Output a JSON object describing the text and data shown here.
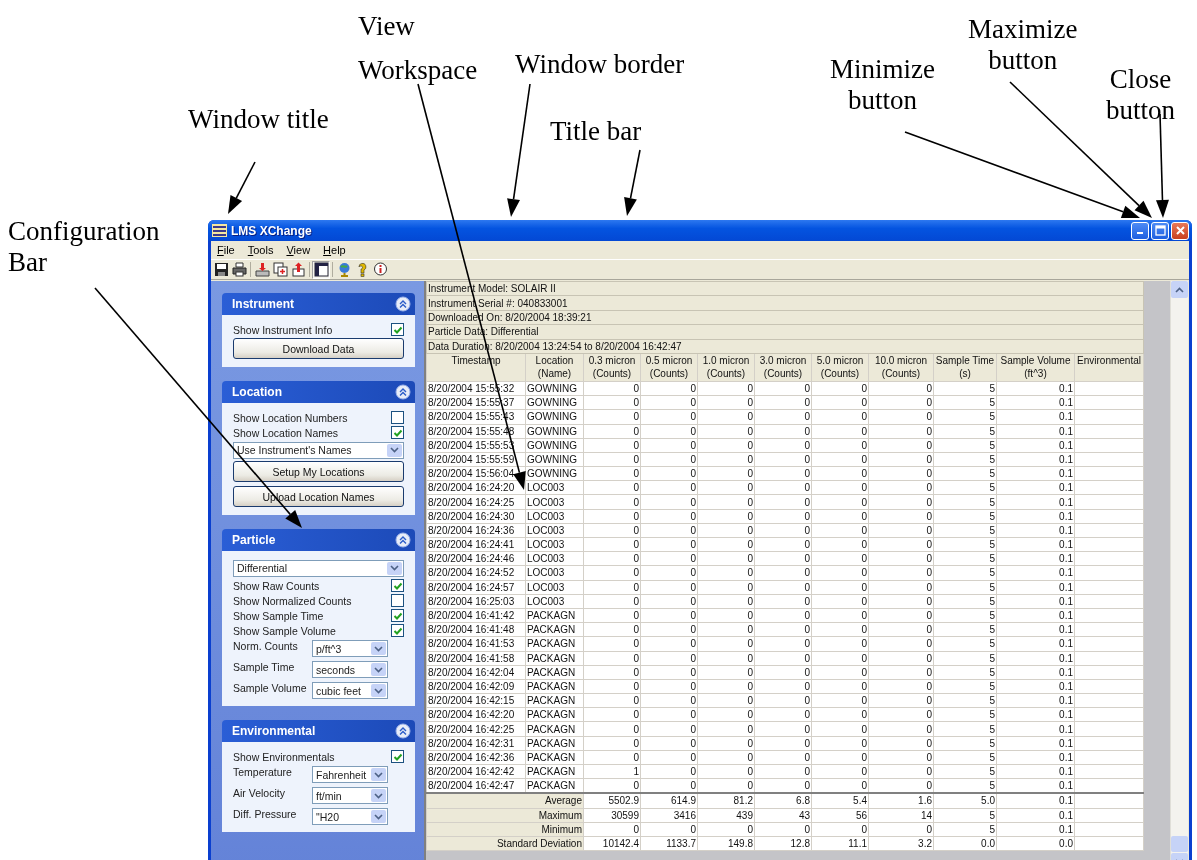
{
  "annotations": [
    {
      "text": "Window title"
    },
    {
      "text": "Configuration\nBar"
    },
    {
      "text": "View\nWorkspace"
    },
    {
      "text": "Window border"
    },
    {
      "text": "Title bar"
    },
    {
      "text": "Minimize\nbutton"
    },
    {
      "text": "Maximize\nbutton"
    },
    {
      "text": "Close\nbutton"
    }
  ],
  "window": {
    "title": "LMS XChange",
    "menu": [
      "File",
      "Tools",
      "View",
      "Help"
    ],
    "toolbar": [
      {
        "kind": "save",
        "pressed": false
      },
      {
        "kind": "print",
        "pressed": false
      },
      {
        "kind": "separator"
      },
      {
        "kind": "download",
        "pressed": false
      },
      {
        "kind": "add",
        "pressed": false
      },
      {
        "kind": "upload",
        "pressed": false
      },
      {
        "kind": "separator"
      },
      {
        "kind": "panel",
        "pressed": true
      },
      {
        "kind": "separator"
      },
      {
        "kind": "globe",
        "pressed": false
      },
      {
        "kind": "help",
        "pressed": false
      },
      {
        "kind": "info",
        "pressed": false
      }
    ]
  },
  "config_bar": {
    "sections": [
      {
        "title": "Instrument",
        "items": [
          {
            "kind": "checkbox",
            "label": "Show Instrument Info",
            "checked": true
          },
          {
            "kind": "button",
            "label": "Download Data"
          }
        ]
      },
      {
        "title": "Location",
        "items": [
          {
            "kind": "checkbox",
            "label": "Show Location Numbers",
            "checked": false
          },
          {
            "kind": "checkbox",
            "label": "Show Location Names",
            "checked": true
          },
          {
            "kind": "dropdown",
            "value": "Use Instrument's Names"
          },
          {
            "kind": "button",
            "label": "Setup My Locations"
          },
          {
            "kind": "button",
            "label": "Upload Location Names"
          }
        ]
      },
      {
        "title": "Particle",
        "items": [
          {
            "kind": "dropdown",
            "value": "Differential"
          },
          {
            "kind": "checkbox",
            "label": "Show Raw Counts",
            "checked": true
          },
          {
            "kind": "checkbox",
            "label": "Show Normalized Counts",
            "checked": false
          },
          {
            "kind": "checkbox",
            "label": "Show Sample Time",
            "checked": true
          },
          {
            "kind": "checkbox",
            "label": "Show Sample Volume",
            "checked": true
          },
          {
            "kind": "labeled_dropdown",
            "label": "Norm. Counts",
            "value": "p/ft^3"
          },
          {
            "kind": "labeled_dropdown",
            "label": "Sample Time",
            "value": "seconds"
          },
          {
            "kind": "labeled_dropdown",
            "label": "Sample Volume",
            "value": "cubic feet"
          }
        ]
      },
      {
        "title": "Environmental",
        "items": [
          {
            "kind": "checkbox",
            "label": "Show Environmentals",
            "checked": true
          },
          {
            "kind": "labeled_dropdown",
            "label": "Temperature",
            "value": "Fahrenheit"
          },
          {
            "kind": "labeled_dropdown",
            "label": "Air Velocity",
            "value": "ft/min"
          },
          {
            "kind": "labeled_dropdown",
            "label": "Diff. Pressure",
            "value": "\"H20"
          }
        ]
      }
    ]
  },
  "workspace": {
    "info": [
      "Instrument Model: SOLAIR II",
      "Instrument Serial #: 040833001",
      "Downloaded On: 8/20/2004 18:39:21",
      "Particle Data: Differential",
      "Data Duration: 8/20/2004 13:24:54 to 8/20/2004 16:42:47"
    ],
    "columns": [
      "Timestamp",
      "Location\n(Name)",
      "0.3 micron\n(Counts)",
      "0.5 micron\n(Counts)",
      "1.0 micron\n(Counts)",
      "3.0 micron\n(Counts)",
      "5.0 micron\n(Counts)",
      "10.0 micron\n(Counts)",
      "Sample Time\n(s)",
      "Sample Volume\n(ft^3)",
      "Environmental"
    ],
    "rows": [
      [
        "8/20/2004 15:55:32",
        "GOWNING",
        "0",
        "0",
        "0",
        "0",
        "0",
        "0",
        "5",
        "0.1"
      ],
      [
        "8/20/2004 15:55:37",
        "GOWNING",
        "0",
        "0",
        "0",
        "0",
        "0",
        "0",
        "5",
        "0.1"
      ],
      [
        "8/20/2004 15:55:43",
        "GOWNING",
        "0",
        "0",
        "0",
        "0",
        "0",
        "0",
        "5",
        "0.1"
      ],
      [
        "8/20/2004 15:55:48",
        "GOWNING",
        "0",
        "0",
        "0",
        "0",
        "0",
        "0",
        "5",
        "0.1"
      ],
      [
        "8/20/2004 15:55:53",
        "GOWNING",
        "0",
        "0",
        "0",
        "0",
        "0",
        "0",
        "5",
        "0.1"
      ],
      [
        "8/20/2004 15:55:59",
        "GOWNING",
        "0",
        "0",
        "0",
        "0",
        "0",
        "0",
        "5",
        "0.1"
      ],
      [
        "8/20/2004 15:56:04",
        "GOWNING",
        "0",
        "0",
        "0",
        "0",
        "0",
        "0",
        "5",
        "0.1"
      ],
      [
        "8/20/2004 16:24:20",
        "LOC003",
        "0",
        "0",
        "0",
        "0",
        "0",
        "0",
        "5",
        "0.1"
      ],
      [
        "8/20/2004 16:24:25",
        "LOC003",
        "0",
        "0",
        "0",
        "0",
        "0",
        "0",
        "5",
        "0.1"
      ],
      [
        "8/20/2004 16:24:30",
        "LOC003",
        "0",
        "0",
        "0",
        "0",
        "0",
        "0",
        "5",
        "0.1"
      ],
      [
        "8/20/2004 16:24:36",
        "LOC003",
        "0",
        "0",
        "0",
        "0",
        "0",
        "0",
        "5",
        "0.1"
      ],
      [
        "8/20/2004 16:24:41",
        "LOC003",
        "0",
        "0",
        "0",
        "0",
        "0",
        "0",
        "5",
        "0.1"
      ],
      [
        "8/20/2004 16:24:46",
        "LOC003",
        "0",
        "0",
        "0",
        "0",
        "0",
        "0",
        "5",
        "0.1"
      ],
      [
        "8/20/2004 16:24:52",
        "LOC003",
        "0",
        "0",
        "0",
        "0",
        "0",
        "0",
        "5",
        "0.1"
      ],
      [
        "8/20/2004 16:24:57",
        "LOC003",
        "0",
        "0",
        "0",
        "0",
        "0",
        "0",
        "5",
        "0.1"
      ],
      [
        "8/20/2004 16:25:03",
        "LOC003",
        "0",
        "0",
        "0",
        "0",
        "0",
        "0",
        "5",
        "0.1"
      ],
      [
        "8/20/2004 16:41:42",
        "PACKAGN",
        "0",
        "0",
        "0",
        "0",
        "0",
        "0",
        "5",
        "0.1"
      ],
      [
        "8/20/2004 16:41:48",
        "PACKAGN",
        "0",
        "0",
        "0",
        "0",
        "0",
        "0",
        "5",
        "0.1"
      ],
      [
        "8/20/2004 16:41:53",
        "PACKAGN",
        "0",
        "0",
        "0",
        "0",
        "0",
        "0",
        "5",
        "0.1"
      ],
      [
        "8/20/2004 16:41:58",
        "PACKAGN",
        "0",
        "0",
        "0",
        "0",
        "0",
        "0",
        "5",
        "0.1"
      ],
      [
        "8/20/2004 16:42:04",
        "PACKAGN",
        "0",
        "0",
        "0",
        "0",
        "0",
        "0",
        "5",
        "0.1"
      ],
      [
        "8/20/2004 16:42:09",
        "PACKAGN",
        "0",
        "0",
        "0",
        "0",
        "0",
        "0",
        "5",
        "0.1"
      ],
      [
        "8/20/2004 16:42:15",
        "PACKAGN",
        "0",
        "0",
        "0",
        "0",
        "0",
        "0",
        "5",
        "0.1"
      ],
      [
        "8/20/2004 16:42:20",
        "PACKAGN",
        "0",
        "0",
        "0",
        "0",
        "0",
        "0",
        "5",
        "0.1"
      ],
      [
        "8/20/2004 16:42:25",
        "PACKAGN",
        "0",
        "0",
        "0",
        "0",
        "0",
        "0",
        "5",
        "0.1"
      ],
      [
        "8/20/2004 16:42:31",
        "PACKAGN",
        "0",
        "0",
        "0",
        "0",
        "0",
        "0",
        "5",
        "0.1"
      ],
      [
        "8/20/2004 16:42:36",
        "PACKAGN",
        "0",
        "0",
        "0",
        "0",
        "0",
        "0",
        "5",
        "0.1"
      ],
      [
        "8/20/2004 16:42:42",
        "PACKAGN",
        "1",
        "0",
        "0",
        "0",
        "0",
        "0",
        "5",
        "0.1"
      ],
      [
        "8/20/2004 16:42:47",
        "PACKAGN",
        "0",
        "0",
        "0",
        "0",
        "0",
        "0",
        "5",
        "0.1"
      ]
    ],
    "stats": [
      {
        "label": "Average",
        "values": [
          "5502.9",
          "614.9",
          "81.2",
          "6.8",
          "5.4",
          "1.6",
          "5.0",
          "0.1"
        ]
      },
      {
        "label": "Maximum",
        "values": [
          "30599",
          "3416",
          "439",
          "43",
          "56",
          "14",
          "5",
          "0.1"
        ]
      },
      {
        "label": "Minimum",
        "values": [
          "0",
          "0",
          "0",
          "0",
          "0",
          "0",
          "5",
          "0.1"
        ]
      },
      {
        "label": "Standard Deviation",
        "values": [
          "10142.4",
          "1133.7",
          "149.8",
          "12.8",
          "11.1",
          "3.2",
          "0.0",
          "0.0"
        ]
      }
    ]
  }
}
